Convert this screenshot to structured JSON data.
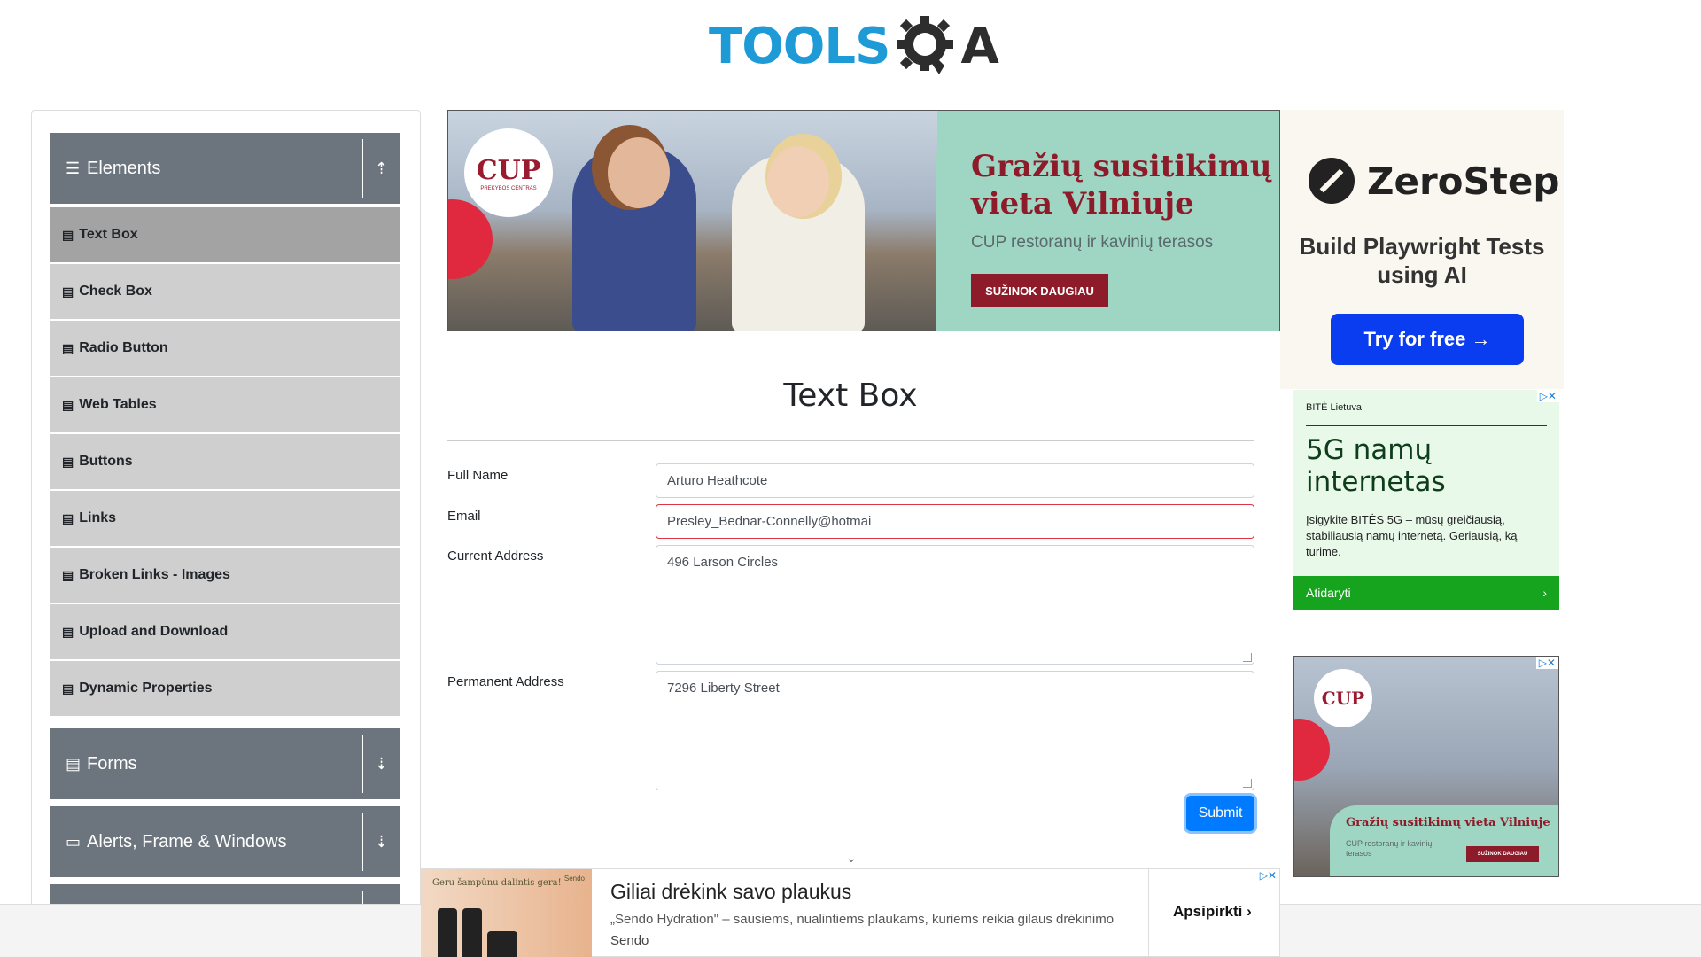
{
  "logo": {
    "tools": "TOOLS",
    "a": "A"
  },
  "sidebar": {
    "groups": [
      {
        "label": "Elements",
        "icon": "hamburger-icon",
        "toggle": "upload-icon"
      },
      {
        "label": "Forms",
        "icon": "form-icon",
        "toggle": "download-icon"
      },
      {
        "label": "Alerts, Frame & Windows",
        "icon": "window-icon",
        "toggle": "download-icon"
      }
    ],
    "items": [
      {
        "label": "Text Box"
      },
      {
        "label": "Check Box"
      },
      {
        "label": "Radio Button"
      },
      {
        "label": "Web Tables"
      },
      {
        "label": "Buttons"
      },
      {
        "label": "Links"
      },
      {
        "label": "Broken Links - Images"
      },
      {
        "label": "Upload and Download"
      },
      {
        "label": "Dynamic Properties"
      }
    ]
  },
  "banner": {
    "logo": "CUP",
    "logo_small": "PREKYBOS CENTRAS",
    "title": "Gražių susitikimų vieta Vilniuje",
    "subtitle": "CUP restoranų ir kavinių terasos",
    "cta": "SUŽINOK DAUGIAU"
  },
  "main": {
    "title": "Text Box",
    "form": {
      "full_name_label": "Full Name",
      "full_name_value": "Arturo Heathcote",
      "email_label": "Email",
      "email_value": "Presley_Bednar-Connelly@hotmai",
      "current_address_label": "Current Address",
      "current_address_value": "496 Larson Circles",
      "permanent_address_label": "Permanent Address",
      "permanent_address_value": "7296 Liberty Street",
      "submit_label": "Submit"
    }
  },
  "ads": {
    "zerostep": {
      "name": "ZeroStep",
      "text": "Build Playwright Tests using AI",
      "button": "Try for free →"
    },
    "bite": {
      "brand": "BITĖ Lietuva",
      "title": "5G namų internetas",
      "text": "Įsigykite BITĖS 5G – mūsų greičiausią, stabiliausią namų internetą. Geriausią, ką turime.",
      "cta": "Atidaryti",
      "cta_arrow": "›"
    },
    "cup_small": {
      "logo": "CUP",
      "title": "Gražių susitikimų vieta Vilniuje",
      "subtitle": "CUP restoranų ir kavinių terasos",
      "cta": "SUŽINOK DAUGIAU"
    },
    "close_glyph": "▷✕",
    "bottom": {
      "tagline": "Geru šampūnu dalintis gera!",
      "brand_small": "Sendo",
      "title": "Giliai drėkink savo plaukus",
      "desc": "„Sendo Hydration\" – sausiems, nualintiems plaukams, kuriems reikia gilaus drėkinimo",
      "source": "Sendo",
      "cta": "Apsipirkti ›"
    }
  },
  "colors": {
    "accent": "#007bff",
    "sidebar_header": "#6c757d",
    "sidebar_item": "#cfcfcf",
    "error": "#dc3545"
  }
}
